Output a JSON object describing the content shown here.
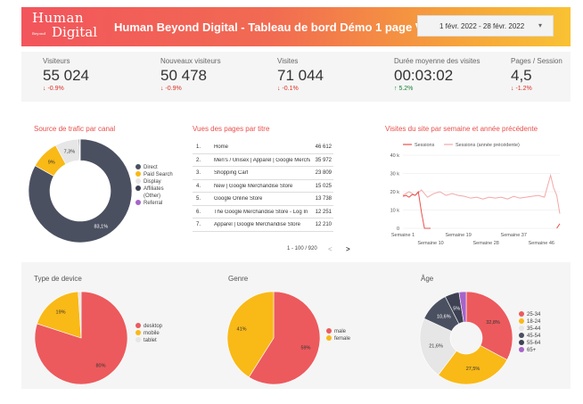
{
  "header": {
    "logo_line1": "Human",
    "logo_line2": "Digital",
    "logo_small": "Beyond",
    "title": "Human Beyond Digital - Tableau de bord Démo 1 page V1",
    "date_range": "1 févr. 2022 - 28 févr. 2022",
    "date_caret": "▾"
  },
  "kpis": [
    {
      "label": "Visiteurs",
      "value": "55 024",
      "change": "↓ -0.9%",
      "trend": "down"
    },
    {
      "label": "Nouveaux visiteurs",
      "value": "50 478",
      "change": "↓ -0.9%",
      "trend": "down"
    },
    {
      "label": "Visites",
      "value": "71 044",
      "change": "↓ -0.1%",
      "trend": "down"
    },
    {
      "label": "Durée moyenne des visites",
      "value": "00:03:02",
      "change": "↑ 5.2%",
      "trend": "up"
    },
    {
      "label": "Pages / Session",
      "value": "4,5",
      "change": "↓ -1.2%",
      "trend": "down"
    }
  ],
  "traffic": {
    "title": "Source de trafic par canal",
    "legend": [
      {
        "label": "Direct",
        "color": "#4b5061"
      },
      {
        "label": "Paid Search",
        "color": "#f9b917"
      },
      {
        "label": "Display",
        "color": "#e6e6e6"
      },
      {
        "label": "Affiliates",
        "color": "#3d4152"
      },
      {
        "label": "(Other)",
        "color": ""
      },
      {
        "label": "Referral",
        "color": "#a764c8"
      }
    ]
  },
  "pages_table": {
    "title": "Vues des pages par titre",
    "rows": [
      {
        "n": "1.",
        "page": "Home",
        "views": "46 612"
      },
      {
        "n": "2.",
        "page": "Men's / Unisex | Apparel | Google Merchan...",
        "views": "35 972"
      },
      {
        "n": "3.",
        "page": "Shopping Cart",
        "views": "23 809"
      },
      {
        "n": "4.",
        "page": "New | Google Merchandise Store",
        "views": "15 025"
      },
      {
        "n": "5.",
        "page": "Google Online Store",
        "views": "13 738"
      },
      {
        "n": "6.",
        "page": "The Google Merchandise Store - Log In",
        "views": "12 251"
      },
      {
        "n": "7.",
        "page": "Apparel | Google Merchandise Store",
        "views": "12 210"
      }
    ],
    "pager": "1 - 100 / 920",
    "prev": "<",
    "next": ">"
  },
  "device_title": "Type de device",
  "genre_title": "Genre",
  "age_title": "Âge",
  "chart_data": [
    {
      "type": "pie",
      "title": "Source de trafic par canal",
      "categories": [
        "Direct",
        "Paid Search",
        "Display",
        "Affiliates",
        "(Other)",
        "Referral"
      ],
      "values": [
        83.1,
        9.0,
        7.3,
        0.3,
        0.2,
        0.1
      ],
      "labels": [
        "83,1%",
        "9%",
        "7,3%",
        "",
        "",
        ""
      ],
      "colors": [
        "#4b5061",
        "#f9b917",
        "#e6e6e6",
        "#3d4152",
        "#9aa0a8",
        "#a764c8"
      ],
      "donut": true
    },
    {
      "type": "line",
      "title": "Visites du site par semaine et année précédente",
      "x_ticks": [
        "Semaine 1",
        "Semaine 10",
        "Semaine 19",
        "Semaine 28",
        "Semaine 37",
        "Semaine 46"
      ],
      "ylim": [
        0,
        40000
      ],
      "y_ticks": [
        "40 k",
        "30 k",
        "20 k",
        "10 k",
        "0"
      ],
      "x_range": [
        1,
        52
      ],
      "series": [
        {
          "name": "Sessions",
          "color": "#e8504c",
          "x": [
            1,
            2,
            3,
            4,
            5,
            6,
            7,
            8,
            9,
            10,
            52
          ],
          "y": [
            17500,
            18000,
            17000,
            18500,
            18000,
            20000,
            9000,
            0,
            0,
            0,
            2500
          ]
        },
        {
          "name": "Sessions (année précédente)",
          "color": "#f4a7a5",
          "x": [
            1,
            3,
            5,
            7,
            9,
            11,
            13,
            15,
            17,
            19,
            21,
            23,
            25,
            27,
            29,
            31,
            33,
            35,
            37,
            39,
            41,
            43,
            45,
            47,
            49,
            50,
            51,
            52
          ],
          "y": [
            18000,
            20000,
            18000,
            21000,
            17000,
            19000,
            20000,
            18000,
            19000,
            18000,
            17500,
            16500,
            17000,
            16000,
            17000,
            16500,
            17000,
            16000,
            17500,
            16500,
            17000,
            17500,
            18000,
            17000,
            29000,
            22000,
            18000,
            8000
          ]
        }
      ]
    },
    {
      "type": "pie",
      "title": "Type de device",
      "categories": [
        "desktop",
        "mobile",
        "tablet"
      ],
      "values": [
        80,
        19,
        1
      ],
      "labels": [
        "80%",
        "19%",
        ""
      ],
      "colors": [
        "#ec5a5d",
        "#f9b917",
        "#e6e6e6"
      ]
    },
    {
      "type": "pie",
      "title": "Genre",
      "categories": [
        "male",
        "female"
      ],
      "values": [
        59,
        41
      ],
      "labels": [
        "59%",
        "41%"
      ],
      "colors": [
        "#ec5a5d",
        "#f9b917"
      ]
    },
    {
      "type": "pie",
      "title": "Âge",
      "categories": [
        "25-34",
        "18-24",
        "35-44",
        "45-54",
        "55-64",
        "65+"
      ],
      "values": [
        32.8,
        27.5,
        21.6,
        10.6,
        5.0,
        2.5
      ],
      "labels": [
        "32,8%",
        "27,5%",
        "21,6%",
        "10,6%",
        "5%",
        ""
      ],
      "colors": [
        "#ec5a5d",
        "#f9b917",
        "#e6e6e6",
        "#4b5061",
        "#3d4152",
        "#a764c8"
      ],
      "donut": true
    }
  ]
}
